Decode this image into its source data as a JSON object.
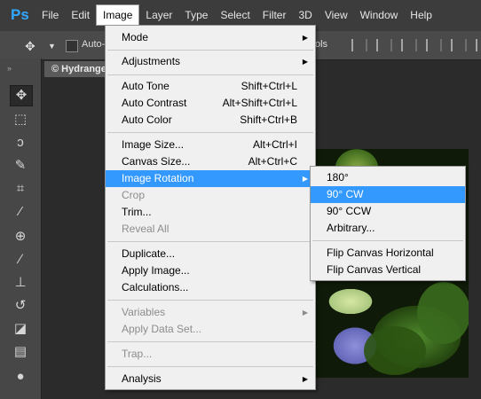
{
  "app": {
    "logo": "Ps",
    "menubar": [
      "File",
      "Edit",
      "Image",
      "Layer",
      "Type",
      "Select",
      "Filter",
      "3D",
      "View",
      "Window",
      "Help"
    ],
    "active_menu": "Image"
  },
  "options_bar": {
    "auto_label": "Auto-",
    "right_fragment": "ols"
  },
  "document_tab": {
    "title": "© Hydrange"
  },
  "image_menu": {
    "groups": [
      [
        {
          "label": "Mode",
          "submenu": true
        }
      ],
      [
        {
          "label": "Adjustments",
          "submenu": true
        }
      ],
      [
        {
          "label": "Auto Tone",
          "shortcut": "Shift+Ctrl+L"
        },
        {
          "label": "Auto Contrast",
          "shortcut": "Alt+Shift+Ctrl+L"
        },
        {
          "label": "Auto Color",
          "shortcut": "Shift+Ctrl+B"
        }
      ],
      [
        {
          "label": "Image Size...",
          "shortcut": "Alt+Ctrl+I"
        },
        {
          "label": "Canvas Size...",
          "shortcut": "Alt+Ctrl+C"
        },
        {
          "label": "Image Rotation",
          "submenu": true,
          "highlighted": true
        },
        {
          "label": "Crop",
          "disabled": true
        },
        {
          "label": "Trim..."
        },
        {
          "label": "Reveal All",
          "disabled": true
        }
      ],
      [
        {
          "label": "Duplicate..."
        },
        {
          "label": "Apply Image..."
        },
        {
          "label": "Calculations..."
        }
      ],
      [
        {
          "label": "Variables",
          "submenu": true,
          "disabled": true
        },
        {
          "label": "Apply Data Set...",
          "disabled": true
        }
      ],
      [
        {
          "label": "Trap...",
          "disabled": true
        }
      ],
      [
        {
          "label": "Analysis",
          "submenu": true
        }
      ]
    ]
  },
  "rotation_submenu": {
    "groups": [
      [
        {
          "label": "180°"
        },
        {
          "label": "90° CW",
          "highlighted": true
        },
        {
          "label": "90° CCW"
        },
        {
          "label": "Arbitrary..."
        }
      ],
      [
        {
          "label": "Flip Canvas Horizontal"
        },
        {
          "label": "Flip Canvas Vertical"
        }
      ]
    ]
  },
  "colors": {
    "highlight": "#3399ff",
    "menu_bg": "#f0f0f0",
    "logo": "#31a8ff"
  }
}
